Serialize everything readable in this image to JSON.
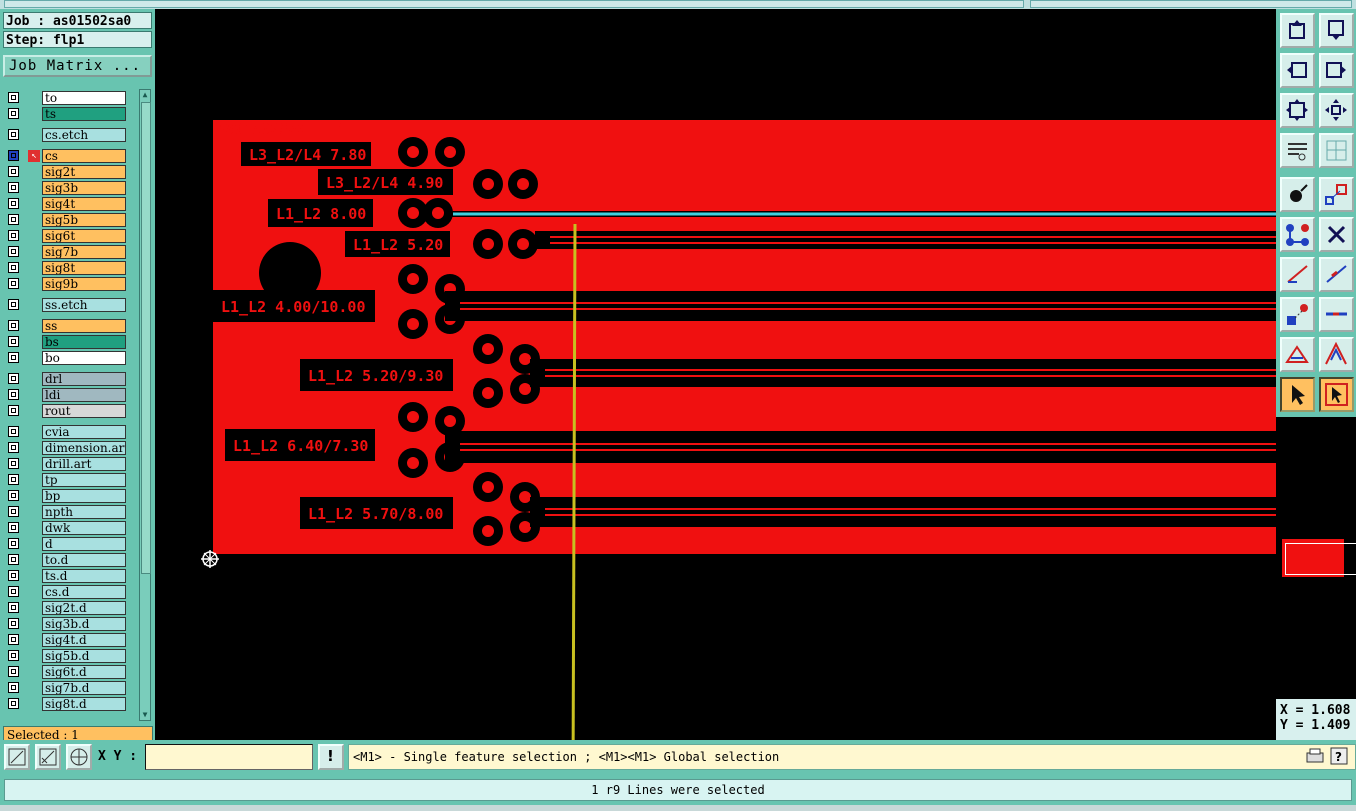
{
  "job": {
    "job_label": "Job : as01502sa0",
    "step_label": "Step: flp1",
    "matrix_button": "Job Matrix ..."
  },
  "layers": [
    {
      "name": "to",
      "color": "#ffffff"
    },
    {
      "name": "ts",
      "color": "#20a080"
    },
    {
      "name": "cs.etch",
      "color": "#a8e0e0"
    },
    {
      "name": "cs",
      "color": "#ffc060",
      "active": true
    },
    {
      "name": "sig2t",
      "color": "#ffc060"
    },
    {
      "name": "sig3b",
      "color": "#ffc060"
    },
    {
      "name": "sig4t",
      "color": "#ffc060"
    },
    {
      "name": "sig5b",
      "color": "#ffc060"
    },
    {
      "name": "sig6t",
      "color": "#ffc060"
    },
    {
      "name": "sig7b",
      "color": "#ffc060"
    },
    {
      "name": "sig8t",
      "color": "#ffc060"
    },
    {
      "name": "sig9b",
      "color": "#ffc060"
    },
    {
      "name": "ss.etch",
      "color": "#a8e0e0"
    },
    {
      "name": "ss",
      "color": "#ffc060"
    },
    {
      "name": "bs",
      "color": "#20a080"
    },
    {
      "name": "bo",
      "color": "#ffffff"
    },
    {
      "name": "drl",
      "color": "#a0b8c0"
    },
    {
      "name": "ldi",
      "color": "#a0b8c0"
    },
    {
      "name": "rout",
      "color": "#d8d8d8"
    },
    {
      "name": "cvia",
      "color": "#a8e0e0"
    },
    {
      "name": "dimension.art",
      "color": "#a8e0e0"
    },
    {
      "name": "drill.art",
      "color": "#a8e0e0"
    },
    {
      "name": "tp",
      "color": "#a8e0e0"
    },
    {
      "name": "bp",
      "color": "#a8e0e0"
    },
    {
      "name": "npth",
      "color": "#a8e0e0"
    },
    {
      "name": "dwk",
      "color": "#a8e0e0"
    },
    {
      "name": "d",
      "color": "#a8e0e0"
    },
    {
      "name": "to.d",
      "color": "#a8e0e0"
    },
    {
      "name": "ts.d",
      "color": "#a8e0e0"
    },
    {
      "name": "cs.d",
      "color": "#a8e0e0"
    },
    {
      "name": "sig2t.d",
      "color": "#a8e0e0"
    },
    {
      "name": "sig3b.d",
      "color": "#a8e0e0"
    },
    {
      "name": "sig4t.d",
      "color": "#a8e0e0"
    },
    {
      "name": "sig5b.d",
      "color": "#a8e0e0"
    },
    {
      "name": "sig6t.d",
      "color": "#a8e0e0"
    },
    {
      "name": "sig7b.d",
      "color": "#a8e0e0"
    },
    {
      "name": "sig8t.d",
      "color": "#a8e0e0"
    }
  ],
  "selected_label": "Selected : 1",
  "board": {
    "title": "AS01502SA0 FLP1",
    "labels": [
      "L3_L2/L4 7.80",
      "L3_L2/L4 4.90",
      "L1_L2 8.00",
      "L1_L2 5.20",
      "L1_L2 4.00/10.00",
      "L1_L2 5.20/9.30",
      "L1_L2 6.40/7.30",
      "L1_L2 5.70/8.00"
    ],
    "copper_color": "#f01010",
    "highlight_color": "#40d0e0"
  },
  "coords": {
    "x": "X = 1.608",
    "y": "Y = 1.409"
  },
  "bottom": {
    "xy_label": "X Y :",
    "xy_value": "",
    "message": "<M1> - Single feature selection ; <M1><M1> Global selection"
  },
  "status": "1 r9 Lines were selected",
  "icons": [
    "snap-icon",
    "measure-icon",
    "grid-icon",
    "warning-icon",
    "print-icon",
    "help-icon",
    "scroll-icon"
  ]
}
